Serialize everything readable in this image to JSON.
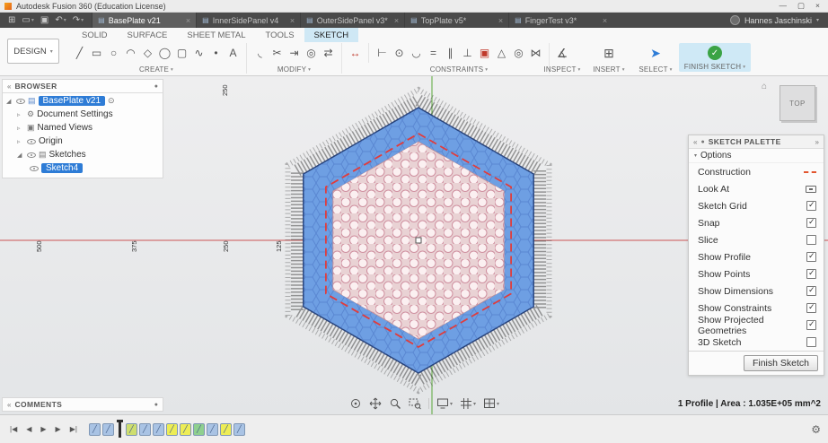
{
  "titlebar": {
    "title": "Autodesk Fusion 360 (Education License)"
  },
  "glyphs": {
    "caret": "▾",
    "collapse": "«",
    "expand": "»",
    "panel_dot": "●",
    "expander_open": "◢",
    "expander_closed": "▹",
    "gear": "⚙",
    "home": "⌂",
    "target": "⊙",
    "min": "—",
    "max": "▢",
    "close": "×",
    "tab_doc": "▤",
    "data_panel": "⊞",
    "file": "▭",
    "save": "▣",
    "undo": "↶",
    "redo": "↷",
    "check": "✓"
  },
  "appbar": {
    "tabs": [
      {
        "label": "BasePlate v21"
      },
      {
        "label": "InnerSidePanel v4"
      },
      {
        "label": "OuterSidePanel v3*"
      },
      {
        "label": "TopPlate v5*"
      },
      {
        "label": "FingerTest v3*"
      }
    ],
    "user": "Hannes Jaschinski"
  },
  "ribbon": {
    "design_label": "DESIGN",
    "tabs": [
      {
        "label": "SOLID"
      },
      {
        "label": "SURFACE"
      },
      {
        "label": "SHEET METAL"
      },
      {
        "label": "TOOLS"
      },
      {
        "label": "SKETCH"
      }
    ],
    "create": {
      "label": "CREATE",
      "icons": [
        {
          "name": "line",
          "glyph": "╱"
        },
        {
          "name": "rectangle",
          "glyph": "▭"
        },
        {
          "name": "circle",
          "glyph": "○"
        },
        {
          "name": "arc",
          "glyph": "◠"
        },
        {
          "name": "polygon",
          "glyph": "◇"
        },
        {
          "name": "ellipse",
          "glyph": "◯"
        },
        {
          "name": "slot",
          "glyph": "▢"
        },
        {
          "name": "spline",
          "glyph": "∿"
        },
        {
          "name": "point",
          "glyph": "•"
        },
        {
          "name": "text",
          "glyph": "A"
        }
      ]
    },
    "modify": {
      "label": "MODIFY",
      "icons": [
        {
          "name": "fillet",
          "glyph": "◟"
        },
        {
          "name": "trim",
          "glyph": "✂"
        },
        {
          "name": "extend",
          "glyph": "⇥"
        },
        {
          "name": "offset",
          "glyph": "◎"
        },
        {
          "name": "move",
          "glyph": "⇄"
        }
      ]
    },
    "dimension": {
      "icons": [
        {
          "name": "sketch-dimension",
          "glyph": "↔"
        }
      ]
    },
    "constraints": {
      "label": "CONSTRAINTS",
      "icons": [
        {
          "name": "horizontal-vertical",
          "glyph": "⊢"
        },
        {
          "name": "coincident",
          "glyph": "⊙"
        },
        {
          "name": "tangent",
          "glyph": "◡"
        },
        {
          "name": "equal",
          "glyph": "="
        },
        {
          "name": "parallel",
          "glyph": "∥"
        },
        {
          "name": "perpendicular",
          "glyph": "⊥"
        },
        {
          "name": "fix-unfix",
          "glyph": "▣"
        },
        {
          "name": "midpoint",
          "glyph": "△"
        },
        {
          "name": "concentric",
          "glyph": "◎"
        },
        {
          "name": "symmetry",
          "glyph": "⋈"
        }
      ]
    },
    "inspect": {
      "label": "INSPECT",
      "glyph": "∡"
    },
    "insert": {
      "label": "INSERT",
      "glyph": "⊞"
    },
    "select": {
      "label": "SELECT",
      "glyph": "➤"
    },
    "finish": {
      "label": "FINISH SKETCH"
    }
  },
  "browser": {
    "title": "BROWSER",
    "root_label": "BasePlate v21",
    "items": [
      {
        "label": "Document Settings"
      },
      {
        "label": "Named Views"
      },
      {
        "label": "Origin"
      },
      {
        "label": "Sketches"
      },
      {
        "label": "Sketch4"
      }
    ]
  },
  "canvas": {
    "dim_labels": [
      {
        "text": "500"
      },
      {
        "text": "375"
      },
      {
        "text": "250"
      },
      {
        "text": "125"
      },
      {
        "text": "250"
      }
    ]
  },
  "viewcube": {
    "top": "TOP"
  },
  "palette": {
    "title": "SKETCH PALETTE",
    "section": "Options",
    "options": [
      {
        "label": "Construction",
        "type": "icon",
        "checked": false
      },
      {
        "label": "Look At",
        "type": "icon",
        "checked": false
      },
      {
        "label": "Sketch Grid",
        "type": "check",
        "checked": true
      },
      {
        "label": "Snap",
        "type": "check",
        "checked": true
      },
      {
        "label": "Slice",
        "type": "check",
        "checked": false
      },
      {
        "label": "Show Profile",
        "type": "check",
        "checked": true
      },
      {
        "label": "Show Points",
        "type": "check",
        "checked": true
      },
      {
        "label": "Show Dimensions",
        "type": "check",
        "checked": true
      },
      {
        "label": "Show Constraints",
        "type": "check",
        "checked": true
      },
      {
        "label": "Show Projected Geometries",
        "type": "check",
        "checked": true
      },
      {
        "label": "3D Sketch",
        "type": "check",
        "checked": false
      }
    ],
    "finish_button": "Finish Sketch"
  },
  "comments": {
    "title": "COMMENTS"
  },
  "statusbar": {
    "info": "1 Profile | Area : 1.035E+05 mm^2"
  },
  "timeline": {
    "controls": [
      {
        "name": "go-to-start",
        "glyph": "|◀"
      },
      {
        "name": "step-back",
        "glyph": "◀"
      },
      {
        "name": "play",
        "glyph": "▶"
      },
      {
        "name": "step-forward",
        "glyph": "▶"
      },
      {
        "name": "go-to-end",
        "glyph": "▶|"
      }
    ],
    "markers": [
      {
        "color": "#a9c3e4"
      },
      {
        "color": "#a9c3e4"
      },
      {
        "color": "#cede6f"
      },
      {
        "color": "#a9c3e4"
      },
      {
        "color": "#a9c3e4"
      },
      {
        "color": "#eded55"
      },
      {
        "color": "#eded55"
      },
      {
        "color": "#8fd08f"
      },
      {
        "color": "#a9c3e4"
      },
      {
        "color": "#eded55"
      },
      {
        "color": "#a9c3e4"
      }
    ]
  },
  "colors": {
    "sketch_blue": "#6e9fe3",
    "construction_red": "#e04545",
    "axis_x": "#cc5555",
    "axis_y": "#59a839",
    "selection": "#2e7cd6",
    "finish_green": "#3ba345",
    "ribbon_active": "#cfe8f5"
  }
}
